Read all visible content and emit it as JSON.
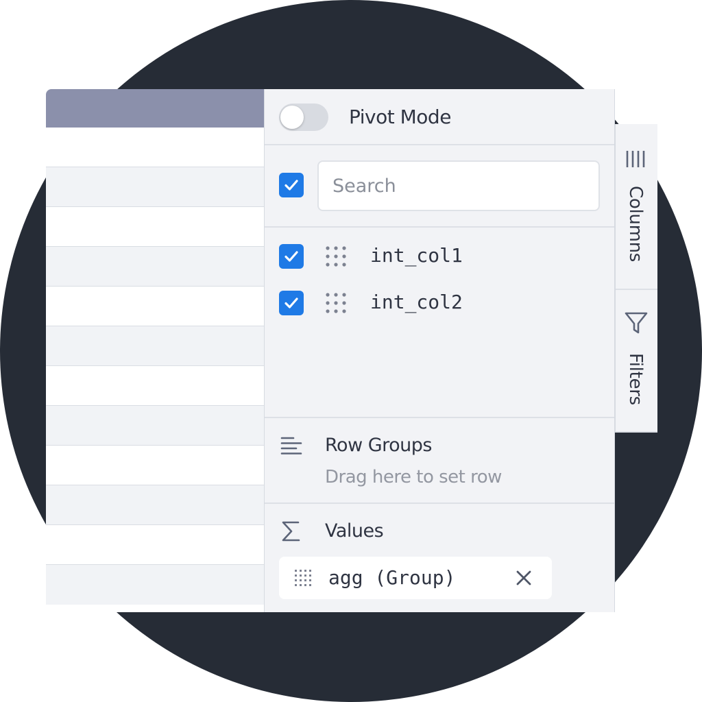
{
  "pivot": {
    "label": "Pivot Mode",
    "enabled": false
  },
  "search": {
    "placeholder": "Search",
    "value": "",
    "select_all_checked": true
  },
  "columns": [
    {
      "label": "int_col1",
      "checked": true
    },
    {
      "label": "int_col2",
      "checked": true
    }
  ],
  "row_groups": {
    "title": "Row Groups",
    "hint": "Drag here to set row"
  },
  "values": {
    "title": "Values",
    "items": [
      {
        "label": "agg (Group)"
      }
    ]
  },
  "sidebar": {
    "tabs": [
      {
        "label": "Columns",
        "icon": "columns-icon"
      },
      {
        "label": "Filters",
        "icon": "filter-icon"
      }
    ]
  },
  "colors": {
    "accent": "#1f7ae6",
    "header": "#8b90ab",
    "background": "#262c36"
  }
}
